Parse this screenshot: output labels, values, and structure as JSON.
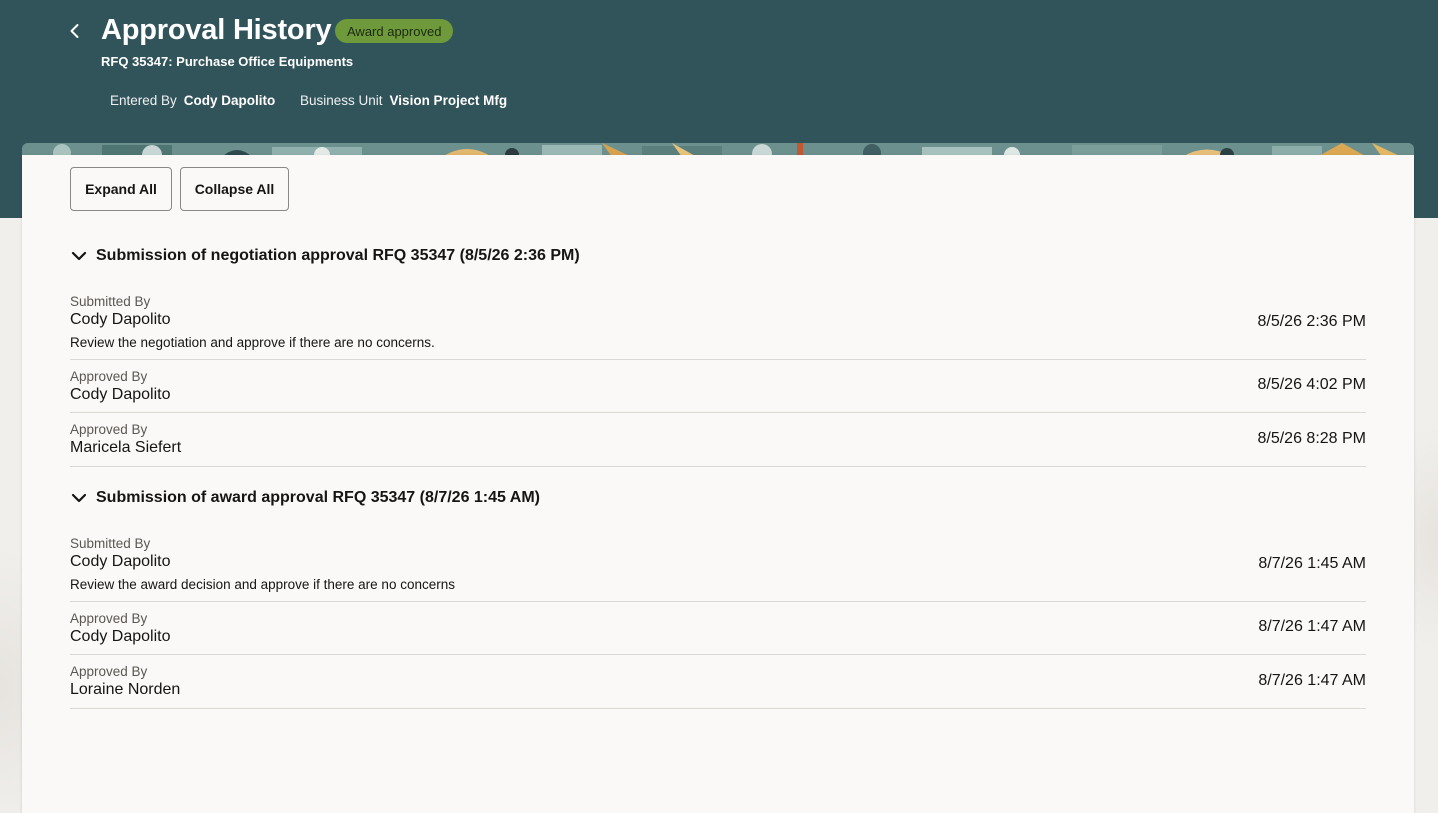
{
  "header": {
    "back_icon": "chevron-left-icon",
    "title": "Approval History",
    "status_badge": "Award approved",
    "subtitle": "RFQ 35347: Purchase Office Equipments",
    "entered_by_label": "Entered By",
    "entered_by_value": "Cody Dapolito",
    "business_unit_label": "Business Unit",
    "business_unit_value": "Vision Project Mfg"
  },
  "toolbar": {
    "expand_all": "Expand All",
    "collapse_all": "Collapse All"
  },
  "sections": [
    {
      "title": "Submission of negotiation approval RFQ 35347 (8/5/26 2:36 PM)",
      "expanded": true,
      "entries": [
        {
          "role": "Submitted By",
          "name": "Cody Dapolito",
          "note": "Review the negotiation and approve if there are no concerns.",
          "date": "8/5/26 2:36 PM"
        },
        {
          "role": "Approved By",
          "name": "Cody Dapolito",
          "date": "8/5/26 4:02 PM"
        },
        {
          "role": "Approved By",
          "name": "Maricela Siefert",
          "date": "8/5/26 8:28 PM"
        }
      ]
    },
    {
      "title": "Submission of award approval RFQ 35347 (8/7/26 1:45 AM)",
      "expanded": true,
      "entries": [
        {
          "role": "Submitted By",
          "name": "Cody Dapolito",
          "note": "Review the award decision and approve if there are no concerns",
          "date": "8/7/26 1:45 AM"
        },
        {
          "role": "Approved By",
          "name": "Cody Dapolito",
          "date": "8/7/26 1:47 AM"
        },
        {
          "role": "Approved By",
          "name": "Loraine Norden",
          "date": "8/7/26 1:47 AM"
        }
      ]
    }
  ],
  "colors": {
    "header_bg": "#31535a",
    "badge_bg": "#6e9a3b",
    "card_bg": "#faf9f7",
    "page_bg": "#f1efec"
  }
}
